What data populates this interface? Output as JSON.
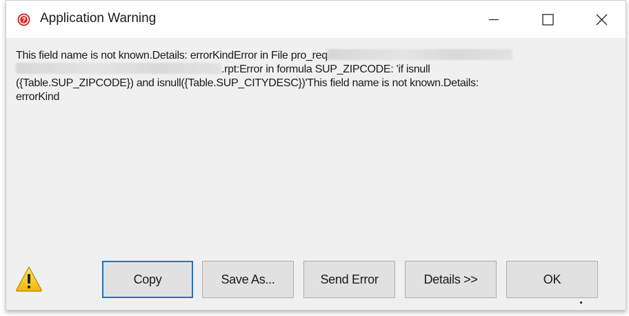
{
  "window": {
    "title": "Application Warning",
    "title_icon": "error-help-icon",
    "controls": {
      "minimize_icon": "minimize-icon",
      "maximize_icon": "maximize-icon",
      "close_icon": "close-icon"
    }
  },
  "message": {
    "line1_text": "This field name is not known.Details: errorKindError in File pro_req",
    "line2_text": ".rpt:Error in formula  SUP_ZIPCODE: 'if isnull",
    "line3_text": "({Table.SUP_ZIPCODE}) and isnull({Table.SUP_CITYDESC})'This field name is not known.Details:",
    "line4_text": "errorKind"
  },
  "footer": {
    "warning_icon": "warning-triangle-icon",
    "buttons": {
      "copy": "Copy",
      "save_as": "Save As...",
      "send_error": "Send Error",
      "details": "Details >>",
      "ok": "OK"
    }
  },
  "colors": {
    "dialog_background": "#f0f0f0",
    "titlebar_background": "#ffffff",
    "default_button_border": "#0078d7",
    "error_icon_red": "#d32f2f",
    "warning_yellow": "#f6c82b"
  }
}
